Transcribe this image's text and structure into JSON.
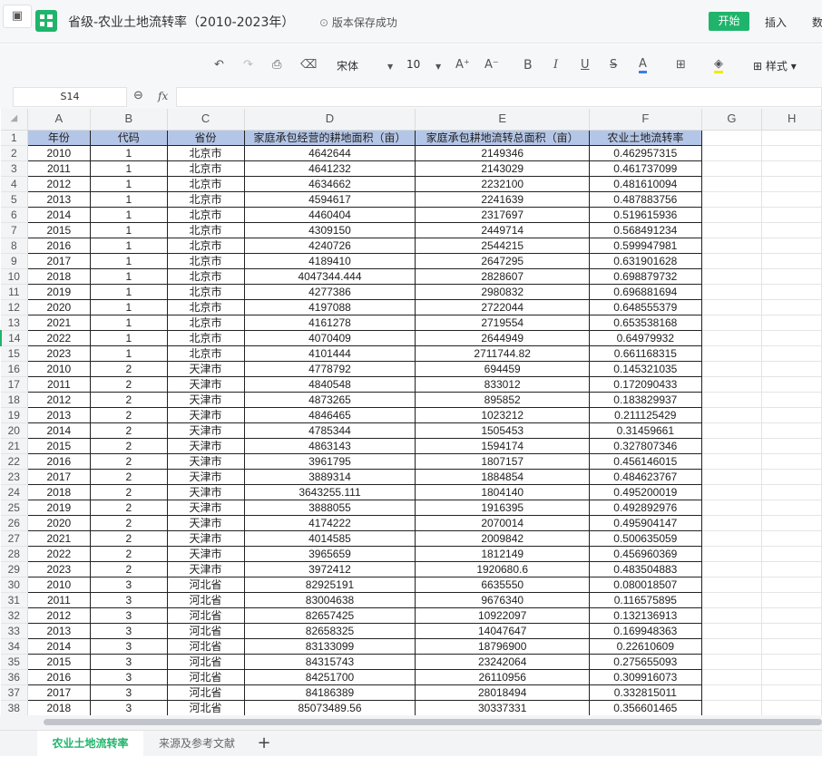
{
  "header": {
    "title": "省级-农业土地流转率（2010-2023年）",
    "save_status": "版本保存成功",
    "tabs": [
      "开始",
      "插入",
      "数"
    ]
  },
  "toolbar": {
    "font": "宋体",
    "size": "10",
    "style_label": "样式"
  },
  "formula_bar": {
    "cell_ref": "S14",
    "fx": "fx",
    "value": ""
  },
  "columns": [
    "A",
    "B",
    "C",
    "D",
    "E",
    "F",
    "G",
    "H"
  ],
  "headers": [
    "年份",
    "代码",
    "省份",
    "家庭承包经营的耕地面积（亩）",
    "家庭承包耕地流转总面积（亩）",
    "农业土地流转率"
  ],
  "rows": [
    [
      "2010",
      "1",
      "北京市",
      "4642644",
      "2149346",
      "0.462957315"
    ],
    [
      "2011",
      "1",
      "北京市",
      "4641232",
      "2143029",
      "0.461737099"
    ],
    [
      "2012",
      "1",
      "北京市",
      "4634662",
      "2232100",
      "0.481610094"
    ],
    [
      "2013",
      "1",
      "北京市",
      "4594617",
      "2241639",
      "0.487883756"
    ],
    [
      "2014",
      "1",
      "北京市",
      "4460404",
      "2317697",
      "0.519615936"
    ],
    [
      "2015",
      "1",
      "北京市",
      "4309150",
      "2449714",
      "0.568491234"
    ],
    [
      "2016",
      "1",
      "北京市",
      "4240726",
      "2544215",
      "0.599947981"
    ],
    [
      "2017",
      "1",
      "北京市",
      "4189410",
      "2647295",
      "0.631901628"
    ],
    [
      "2018",
      "1",
      "北京市",
      "4047344.444",
      "2828607",
      "0.698879732"
    ],
    [
      "2019",
      "1",
      "北京市",
      "4277386",
      "2980832",
      "0.696881694"
    ],
    [
      "2020",
      "1",
      "北京市",
      "4197088",
      "2722044",
      "0.648555379"
    ],
    [
      "2021",
      "1",
      "北京市",
      "4161278",
      "2719554",
      "0.653538168"
    ],
    [
      "2022",
      "1",
      "北京市",
      "4070409",
      "2644949",
      "0.64979932"
    ],
    [
      "2023",
      "1",
      "北京市",
      "4101444",
      "2711744.82",
      "0.661168315"
    ],
    [
      "2010",
      "2",
      "天津市",
      "4778792",
      "694459",
      "0.145321035"
    ],
    [
      "2011",
      "2",
      "天津市",
      "4840548",
      "833012",
      "0.172090433"
    ],
    [
      "2012",
      "2",
      "天津市",
      "4873265",
      "895852",
      "0.183829937"
    ],
    [
      "2013",
      "2",
      "天津市",
      "4846465",
      "1023212",
      "0.211125429"
    ],
    [
      "2014",
      "2",
      "天津市",
      "4785344",
      "1505453",
      "0.31459661"
    ],
    [
      "2015",
      "2",
      "天津市",
      "4863143",
      "1594174",
      "0.327807346"
    ],
    [
      "2016",
      "2",
      "天津市",
      "3961795",
      "1807157",
      "0.456146015"
    ],
    [
      "2017",
      "2",
      "天津市",
      "3889314",
      "1884854",
      "0.484623767"
    ],
    [
      "2018",
      "2",
      "天津市",
      "3643255.111",
      "1804140",
      "0.495200019"
    ],
    [
      "2019",
      "2",
      "天津市",
      "3888055",
      "1916395",
      "0.492892976"
    ],
    [
      "2020",
      "2",
      "天津市",
      "4174222",
      "2070014",
      "0.495904147"
    ],
    [
      "2021",
      "2",
      "天津市",
      "4014585",
      "2009842",
      "0.500635059"
    ],
    [
      "2022",
      "2",
      "天津市",
      "3965659",
      "1812149",
      "0.456960369"
    ],
    [
      "2023",
      "2",
      "天津市",
      "3972412",
      "1920680.6",
      "0.483504883"
    ],
    [
      "2010",
      "3",
      "河北省",
      "82925191",
      "6635550",
      "0.080018507"
    ],
    [
      "2011",
      "3",
      "河北省",
      "83004638",
      "9676340",
      "0.116575895"
    ],
    [
      "2012",
      "3",
      "河北省",
      "82657425",
      "10922097",
      "0.132136913"
    ],
    [
      "2013",
      "3",
      "河北省",
      "82658325",
      "14047647",
      "0.169948363"
    ],
    [
      "2014",
      "3",
      "河北省",
      "83133099",
      "18796900",
      "0.22610609"
    ],
    [
      "2015",
      "3",
      "河北省",
      "84315743",
      "23242064",
      "0.275655093"
    ],
    [
      "2016",
      "3",
      "河北省",
      "84251700",
      "26110956",
      "0.309916073"
    ],
    [
      "2017",
      "3",
      "河北省",
      "84186389",
      "28018494",
      "0.332815011"
    ],
    [
      "2018",
      "3",
      "河北省",
      "85073489.56",
      "30337331",
      "0.356601465"
    ]
  ],
  "sheets": {
    "active": "农业土地流转率",
    "other": "来源及参考文献",
    "add": "+"
  },
  "colors": {
    "accent": "#1fb46b",
    "header_fill": "#b4c6e7"
  }
}
